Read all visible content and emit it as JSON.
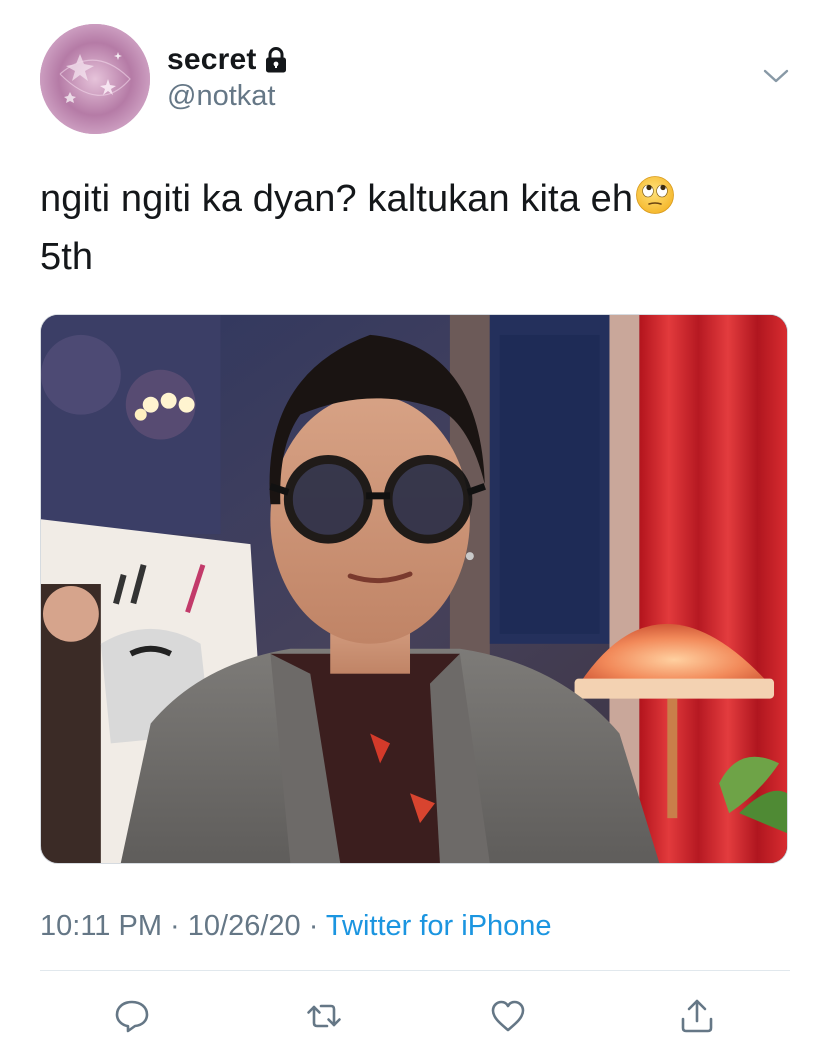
{
  "author": {
    "display_name": "secret",
    "handle": "@notkat",
    "protected_icon": "lock-icon",
    "avatar": "sparkle-pink-avatar"
  },
  "tweet": {
    "text_line1": "ngiti ngiti ka dyan? kaltukan kita eh",
    "emoji": "face-with-rolling-eyes",
    "text_line2": "5th"
  },
  "media": {
    "alt": "photo"
  },
  "metadata": {
    "time": "10:11 PM",
    "separator1": " · ",
    "date": "10/26/20",
    "separator2": " · ",
    "source": "Twitter for iPhone"
  },
  "actions": [
    {
      "icon": "reply-icon"
    },
    {
      "icon": "retweet-icon"
    },
    {
      "icon": "like-icon"
    },
    {
      "icon": "share-icon"
    }
  ],
  "colors": {
    "text": "#14171a",
    "secondary": "#657786",
    "link": "#1b95e0",
    "divider": "#e1e8ed"
  }
}
